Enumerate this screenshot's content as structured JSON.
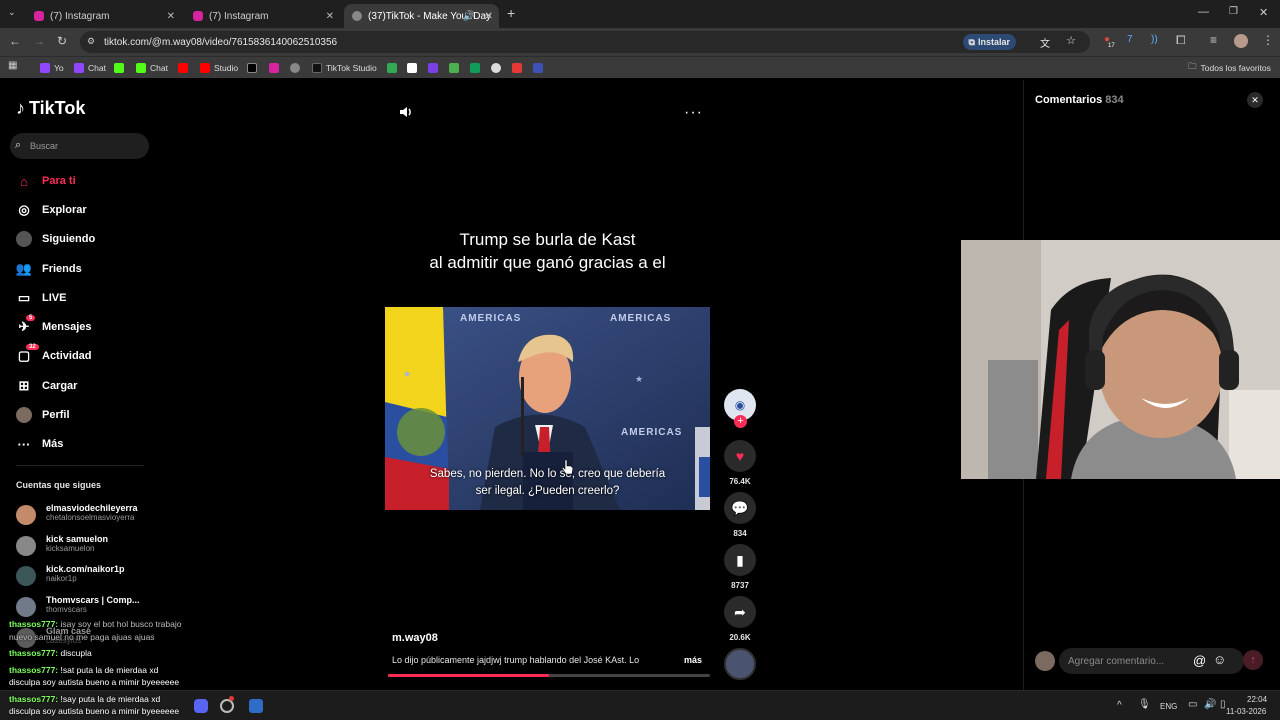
{
  "browser": {
    "tabs": [
      {
        "title": "(7) Instagram",
        "active": false
      },
      {
        "title": "(7) Instagram",
        "active": false
      },
      {
        "title": "(37)TikTok - Make Your Day",
        "active": true
      }
    ],
    "url": "tiktok.com/@m.way08/video/7615836140062510356",
    "install_label": "Instalar",
    "bookmarks": [
      "Yo",
      "Chat",
      "Chat",
      "Studio",
      "TikTok Studio"
    ],
    "all_bookmarks_label": "Todos los favoritos",
    "ext_badge": "17"
  },
  "tiktok": {
    "logo": "TikTok",
    "search_placeholder": "Buscar",
    "nav": [
      {
        "label": "Para ti",
        "icon": "home-icon",
        "active": true
      },
      {
        "label": "Explorar",
        "icon": "compass-icon"
      },
      {
        "label": "Siguiendo",
        "icon": "following-icon"
      },
      {
        "label": "Friends",
        "icon": "friends-icon"
      },
      {
        "label": "LIVE",
        "icon": "live-icon"
      },
      {
        "label": "Mensajes",
        "icon": "messages-icon",
        "badge": "5"
      },
      {
        "label": "Actividad",
        "icon": "activity-icon",
        "badge": "32"
      },
      {
        "label": "Cargar",
        "icon": "upload-icon"
      },
      {
        "label": "Perfil",
        "icon": "profile-icon"
      },
      {
        "label": "Más",
        "icon": "more-icon"
      }
    ],
    "following_title": "Cuentas que sigues",
    "following": [
      {
        "name": "elmasviodechileyerra",
        "handle": "chetalonsoelmasvioyerra"
      },
      {
        "name": "kick samuelon",
        "handle": "kicksamuelon"
      },
      {
        "name": "kick.com/naikor1p",
        "handle": "naikor1p"
      },
      {
        "name": "Thomvscars | Comp...",
        "handle": "thomvscars"
      },
      {
        "name": "Glam case",
        "handle": "casesylos"
      }
    ]
  },
  "chat": [
    {
      "user": "thassos777:",
      "text": "isay soy el bot hol busco trabajo",
      "old": true
    },
    {
      "user": "",
      "text": "nuevo samuel no me paga ajuas ajuas",
      "old": true
    },
    {
      "user": "thassos777:",
      "text": "discupla"
    },
    {
      "user": "thassos777:",
      "text": "!sat puta la de mierdaa xd"
    },
    {
      "user": "",
      "text": "disculpa soy autista bueno a mimir byeeeeee"
    },
    {
      "user": "thassos777:",
      "text": "!say puta la de mierdaa xd"
    },
    {
      "user": "",
      "text": "disculpa soy autista bueno a mimir byeeeeee"
    }
  ],
  "video": {
    "title_line1": "Trump se burla de Kast",
    "title_line2": "al admitir que ganó gracias a el",
    "subtitle_line1": "Sabes, no pierden. No lo sé, creo que debería",
    "subtitle_line2": "ser ilegal. ¿Pueden creerlo?",
    "author": "m.way08",
    "caption": "Lo dijo públicamente jajdjwj trump hablando del José KAst. Lo",
    "more_label": "más",
    "progress": 0.5,
    "backdrop_text": "AMERICAS"
  },
  "actions": {
    "likes": "76.4K",
    "comments": "834",
    "saves": "8737",
    "shares": "20.6K"
  },
  "comments_panel": {
    "title": "Comentarios",
    "count": "834",
    "input_placeholder": "Agregar comentario..."
  },
  "taskbar": {
    "lang": "ENG",
    "time": "22:04",
    "date": "11-03-2026"
  },
  "colors": {
    "accent": "#fe2c55",
    "chat_user": "#7dff5e"
  }
}
